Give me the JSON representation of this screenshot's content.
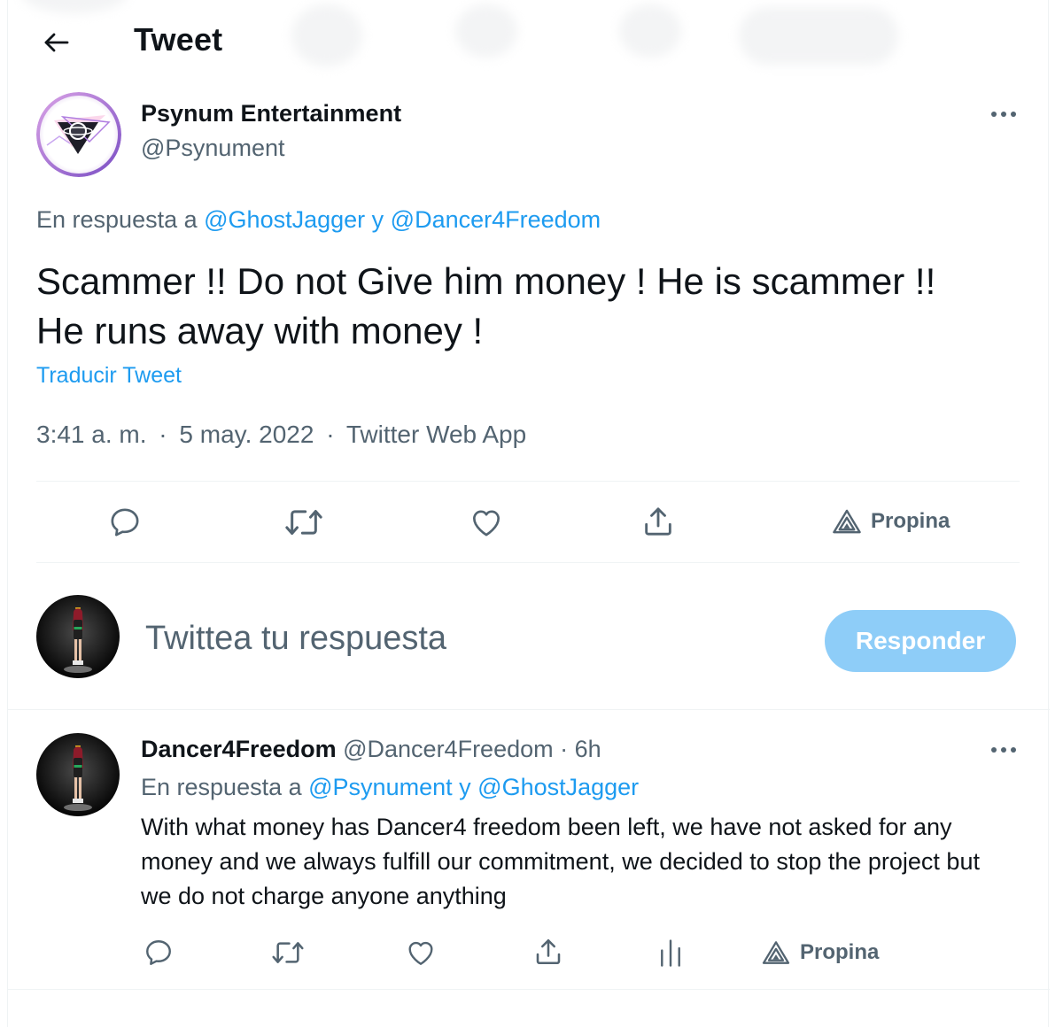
{
  "header": {
    "title": "Tweet"
  },
  "tweet": {
    "author_name": "Psynum Entertainment",
    "author_handle": "@Psynument",
    "reply_prefix": "En respuesta a",
    "reply_user1": "@GhostJagger",
    "reply_joiner": "y",
    "reply_user2": "@Dancer4Freedom",
    "text_line1": "Scammer !! Do not Give him money ! He is scammer !!",
    "text_line2": "He runs away with money !",
    "translate_label": "Traducir Tweet",
    "time": "3:41 a. m.",
    "date": "5 may. 2022",
    "source": "Twitter Web App",
    "meta_sep": "·",
    "tip_label": "Propina"
  },
  "composer": {
    "placeholder": "Twittea tu respuesta",
    "reply_button": "Responder"
  },
  "reply": {
    "author_name": "Dancer4Freedom",
    "author_handle": "@Dancer4Freedom",
    "sep": "·",
    "age": "6h",
    "reply_prefix": "En respuesta a",
    "reply_user1": "@Psynument",
    "reply_joiner": "y",
    "reply_user2": "@GhostJagger",
    "text": "With what money has Dancer4 freedom been left, we have not asked for any money and we always fulfill our commitment, we decided to stop the project but we do not charge anyone anything",
    "tip_label": "Propina"
  },
  "colors": {
    "accent": "#1d9bf0",
    "reply_button": "#8ecdf8",
    "secondary_text": "#536471",
    "divider": "#eff3f4"
  },
  "icons": [
    "back-arrow-icon",
    "more-icon",
    "reply-icon",
    "retweet-icon",
    "like-icon",
    "share-icon",
    "tip-icon",
    "analytics-icon"
  ]
}
